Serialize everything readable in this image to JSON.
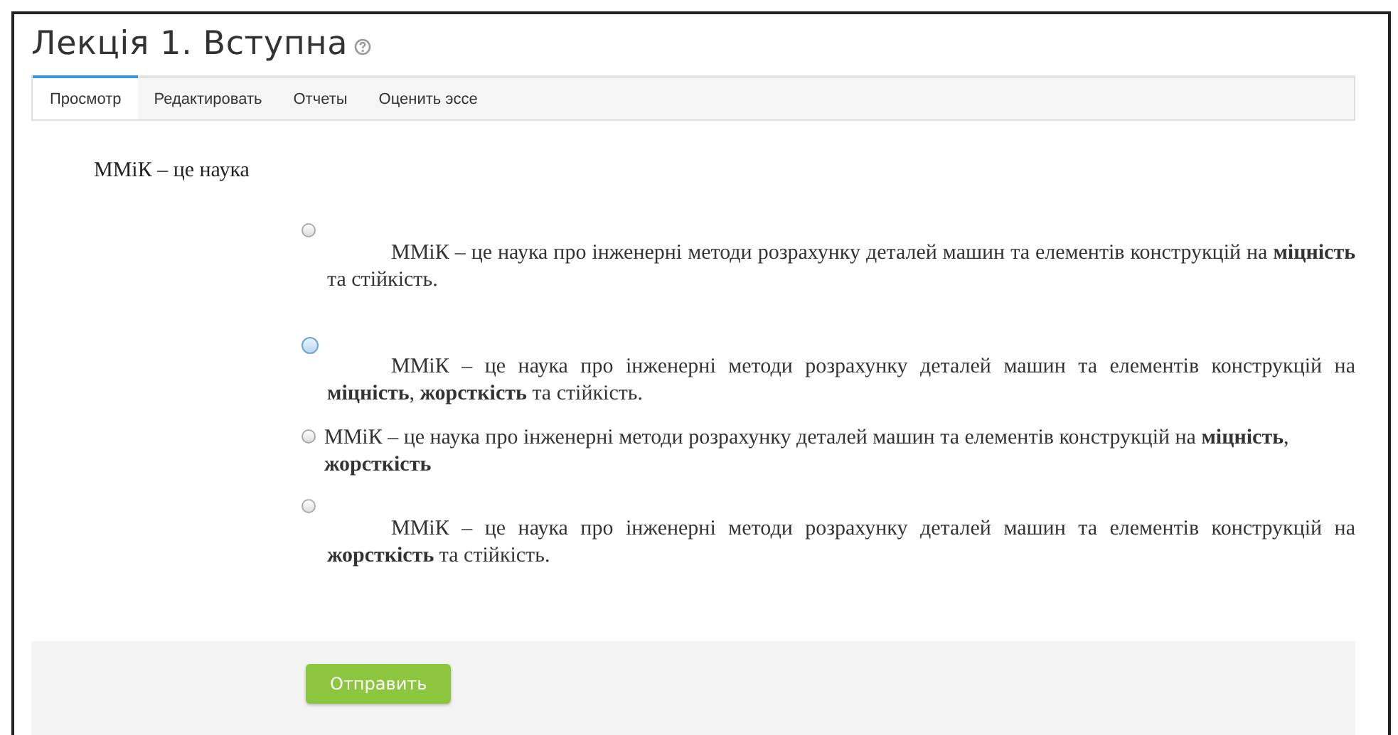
{
  "page": {
    "title": "Лекція 1. Вступна"
  },
  "tabs": [
    {
      "label": "Просмотр",
      "selected": true
    },
    {
      "label": "Редактировать",
      "selected": false
    },
    {
      "label": "Отчеты",
      "selected": false
    },
    {
      "label": "Оценить эссе",
      "selected": false
    }
  ],
  "question": "ММіК – це наука",
  "options": [
    {
      "kind": "indented",
      "text": "ММіК – це наука про інженерні методи розрахунку деталей машин та елементів конструкцій на **міцність** та стійкість.",
      "selected": false,
      "focused": false
    },
    {
      "kind": "indented",
      "text": "ММіК – це наука про інженерні методи розрахунку деталей машин та елементів конструкцій на **міцність**, **жорсткість** та стійкість.",
      "selected": false,
      "focused": true
    },
    {
      "kind": "inline",
      "text": "ММіК – це наука про інженерні методи розрахунку деталей машин та елементів конструкцій на **міцність**, **жорсткість**",
      "selected": false,
      "focused": false
    },
    {
      "kind": "indented",
      "text": "ММіК – це наука про інженерні методи розрахунку деталей машин та елементів конструкцій на **жорсткість** та стійкість.",
      "selected": false,
      "focused": false
    }
  ],
  "submit_button": "Отправить"
}
